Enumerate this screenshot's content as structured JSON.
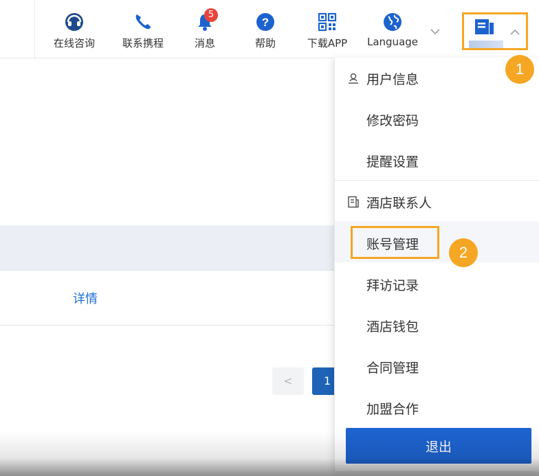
{
  "header": {
    "nav": [
      {
        "id": "online-consult",
        "label": "在线咨询",
        "icon": "headset-icon"
      },
      {
        "id": "contact-ctrip",
        "label": "联系携程",
        "icon": "phone-icon"
      },
      {
        "id": "messages",
        "label": "消息",
        "icon": "bell-icon",
        "badge": "5"
      },
      {
        "id": "help",
        "label": "帮助",
        "icon": "help-circle-icon"
      },
      {
        "id": "download-app",
        "label": "下载APP",
        "icon": "qr-code-icon"
      },
      {
        "id": "language",
        "label": "Language",
        "icon": "globe-icon"
      }
    ],
    "account_icon": "document-icon"
  },
  "steps": {
    "one": "1",
    "two": "2"
  },
  "page": {
    "detail_link": "详情",
    "pagination": {
      "prev": "<",
      "current": "1"
    }
  },
  "dropdown": {
    "items": [
      {
        "label": "用户信息",
        "icon": "user-icon"
      },
      {
        "label": "修改密码"
      },
      {
        "label": "提醒设置"
      },
      {
        "label": "酒店联系人",
        "icon": "document-icon"
      },
      {
        "label": "账号管理"
      },
      {
        "label": "拜访记录"
      },
      {
        "label": "酒店钱包"
      },
      {
        "label": "合同管理"
      },
      {
        "label": "加盟合作"
      }
    ],
    "logout": "退出"
  },
  "colors": {
    "brand_blue": "#1d63cf",
    "highlight_orange": "#f5a623",
    "badge_red": "#e8443b",
    "link_blue": "#1e6fd9"
  }
}
